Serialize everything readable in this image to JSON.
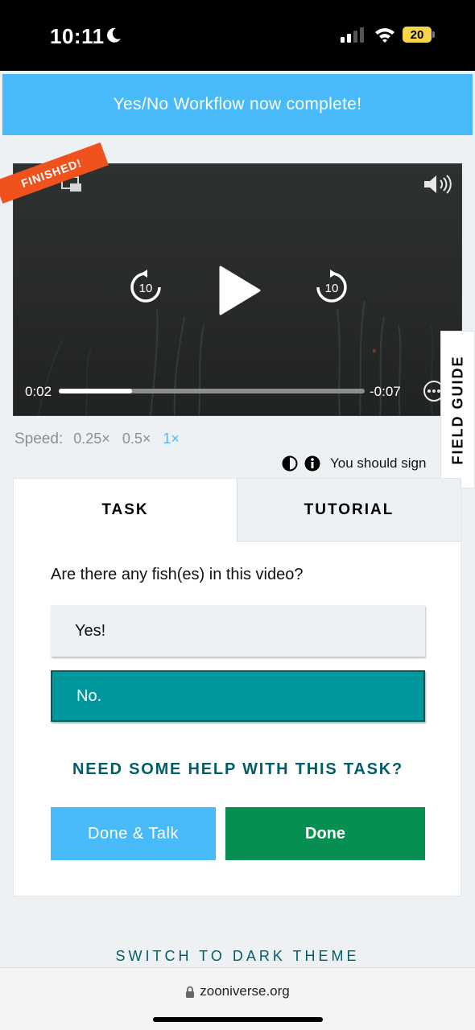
{
  "status_bar": {
    "time": "10:11",
    "battery": "20"
  },
  "banner": {
    "text": "Yes/No Workflow now complete!"
  },
  "video": {
    "ribbon": "FINISHED!",
    "elapsed": "0:02",
    "remaining": "-0:07",
    "progress_fraction": 0.24,
    "rewind_seconds": "10",
    "forward_seconds": "10"
  },
  "speed": {
    "label": "Speed:",
    "options": [
      "0.25×",
      "0.5×",
      "1×"
    ],
    "selected": "1×"
  },
  "notice": {
    "text": "You should sign"
  },
  "field_guide": {
    "label": "FIELD GUIDE"
  },
  "task": {
    "tabs": [
      "TASK",
      "TUTORIAL"
    ],
    "question": "Are there any fish(es) in this video?",
    "answers": [
      "Yes!",
      "No."
    ],
    "selected_answer": "No.",
    "help": "NEED SOME HELP WITH THIS TASK?",
    "done_talk": "Done & Talk",
    "done": "Done"
  },
  "theme_toggle": "SWITCH TO DARK THEME",
  "browser": {
    "url": "zooniverse.org"
  },
  "colors": {
    "banner": "#48baf9",
    "ribbon": "#f0521d",
    "selected_answer": "#00979d",
    "done": "#078f52",
    "help_text": "#005d69"
  }
}
